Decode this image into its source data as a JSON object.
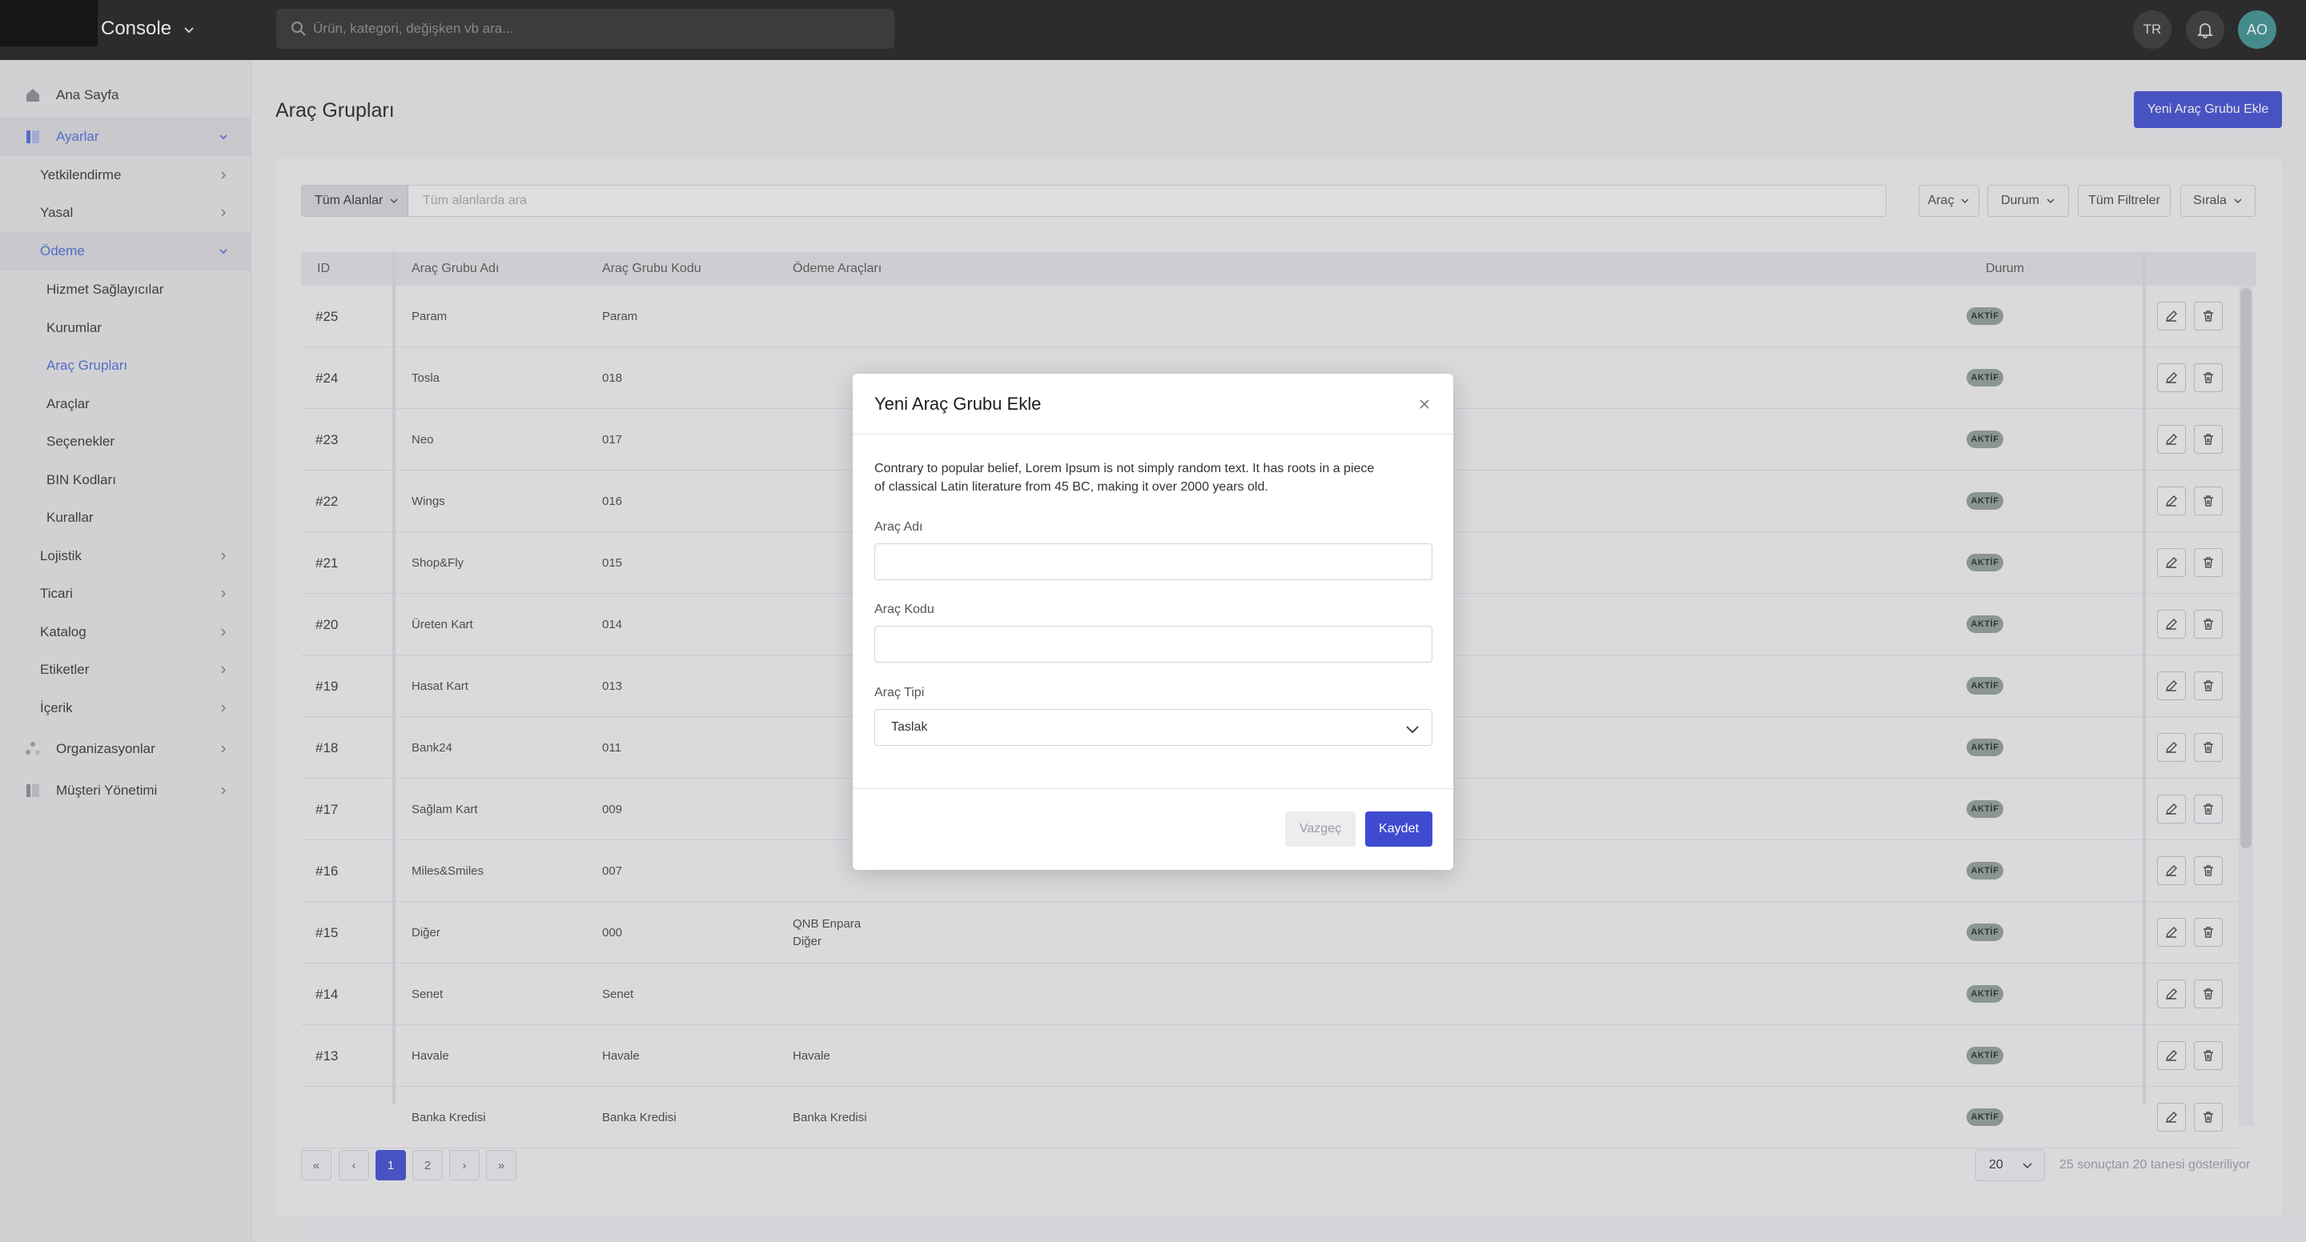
{
  "topbar": {
    "brand": "Console",
    "search_placeholder": "Ürün, kategori, değişken vb ara...",
    "lang": "TR",
    "avatar": "AO"
  },
  "sidebar": {
    "home": "Ana Sayfa",
    "settings": "Ayarlar",
    "auth": "Yetkilendirme",
    "legal": "Yasal",
    "payment": "Ödeme",
    "payment_children": [
      "Hizmet Sağlayıcılar",
      "Kurumlar",
      "Araç Grupları",
      "Araçlar",
      "Seçenekler",
      "BIN Kodları",
      "Kurallar"
    ],
    "logistics": "Lojistik",
    "commerce": "Ticari",
    "catalog": "Katalog",
    "labels": "Etiketler",
    "content": "İçerik",
    "organizations": "Organizasyonlar",
    "customer_mgmt": "Müşteri Yönetimi"
  },
  "page": {
    "title": "Araç Grupları",
    "add_button": "Yeni Araç Grubu Ekle"
  },
  "filters": {
    "field_select": "Tüm Alanlar",
    "search_placeholder": "Tüm alanlarda ara",
    "chip_tool": "Araç",
    "chip_status": "Durum",
    "chip_all_filters": "Tüm Filtreler",
    "chip_sort": "Sırala"
  },
  "table": {
    "headers": [
      "ID",
      "Araç Grubu Adı",
      "Araç Grubu Kodu",
      "Ödeme Araçları",
      "Durum"
    ],
    "status_label": "AKTİF",
    "rows": [
      {
        "id": "#25",
        "name": "Param",
        "code": "Param",
        "tools": [
          "",
          ""
        ]
      },
      {
        "id": "#24",
        "name": "Tosla",
        "code": "018",
        "tools": [
          "",
          ""
        ]
      },
      {
        "id": "#23",
        "name": "Neo",
        "code": "017",
        "tools": [
          "",
          ""
        ]
      },
      {
        "id": "#22",
        "name": "Wings",
        "code": "016",
        "tools": [
          "",
          ""
        ]
      },
      {
        "id": "#21",
        "name": "Shop&Fly",
        "code": "015",
        "tools": [
          "",
          ""
        ]
      },
      {
        "id": "#20",
        "name": "Üreten Kart",
        "code": "014",
        "tools": [
          "",
          ""
        ]
      },
      {
        "id": "#19",
        "name": "Hasat Kart",
        "code": "013",
        "tools": [
          "",
          ""
        ]
      },
      {
        "id": "#18",
        "name": "Bank24",
        "code": "011",
        "tools": [
          "",
          ""
        ]
      },
      {
        "id": "#17",
        "name": "Sağlam Kart",
        "code": "009",
        "tools": [
          "",
          ""
        ]
      },
      {
        "id": "#16",
        "name": "Miles&Smiles",
        "code": "007",
        "tools": [
          "",
          ""
        ]
      },
      {
        "id": "#15",
        "name": "Diğer",
        "code": "000",
        "tools": [
          "QNB Enpara",
          "Diğer"
        ]
      },
      {
        "id": "#14",
        "name": "Senet",
        "code": "Senet",
        "tools": [
          "",
          ""
        ]
      },
      {
        "id": "#13",
        "name": "Havale",
        "code": "Havale",
        "tools": [
          "Havale",
          ""
        ]
      },
      {
        "id": "",
        "name": "Banka Kredisi",
        "code": "Banka Kredisi",
        "tools": [
          "Banka Kredisi",
          ""
        ]
      }
    ]
  },
  "pagination": {
    "first": "«",
    "prev": "‹",
    "pages": [
      "1",
      "2"
    ],
    "next": "›",
    "last": "»",
    "page_size": "20",
    "info": "25 sonuçtan 20 tanesi gösteriliyor"
  },
  "modal": {
    "title": "Yeni Araç Grubu Ekle",
    "description": "Contrary to popular belief, Lorem Ipsum is not simply random text. It has roots in a piece of classical Latin literature from 45 BC, making it over 2000 years old.",
    "name_label": "Araç Adı",
    "name_value": "",
    "code_label": "Araç Kodu",
    "code_value": "",
    "type_label": "Araç Tipi",
    "type_value": "Taslak",
    "cancel": "Vazgeç",
    "save": "Kaydet"
  },
  "colors": {
    "accent": "#3e4bd1",
    "topbar": "#1b1b1b",
    "avatar": "#3a8f8f",
    "active_nav": "#4d6ad6"
  }
}
